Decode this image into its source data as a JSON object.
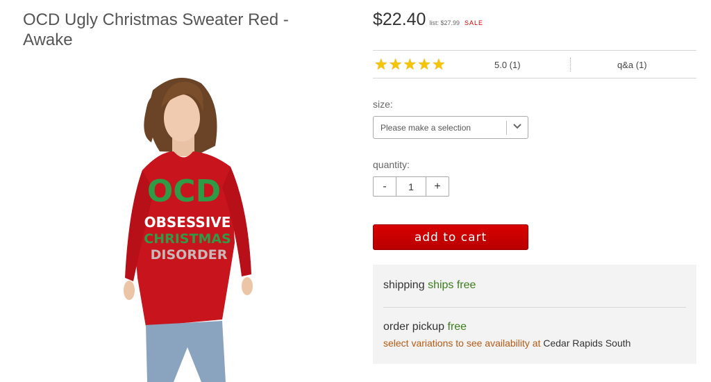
{
  "product": {
    "title": "OCD Ugly Christmas Sweater Red - Awake",
    "image_alt": "model wearing red OCD christmas sweater",
    "sweater_lines": [
      "OCD",
      "OBSESSIVE",
      "CHRISTMAS",
      "DISORDER"
    ]
  },
  "pricing": {
    "price": "$22.40",
    "list_price": "list: $27.99",
    "sale_label": "SALE"
  },
  "rating": {
    "stars": 5,
    "star_icon": "star-icon",
    "score_text": "5.0 (1)",
    "qa_text": "q&a (1)"
  },
  "size": {
    "label": "size:",
    "placeholder": "Please make a selection"
  },
  "quantity": {
    "label": "quantity:",
    "minus": "-",
    "value": "1",
    "plus": "+"
  },
  "cart": {
    "button_label": "add to cart",
    "button_color": "#cc0000"
  },
  "shipping": {
    "label": "shipping",
    "status": "ships free"
  },
  "pickup": {
    "label": "order pickup",
    "status": "free",
    "availability_link": "select variations to see availability",
    "at": "at",
    "store": "Cedar Rapids South"
  },
  "colors": {
    "accent_red": "#cc0000",
    "free_green": "#3b7d1a",
    "link_orange": "#b55a14"
  }
}
